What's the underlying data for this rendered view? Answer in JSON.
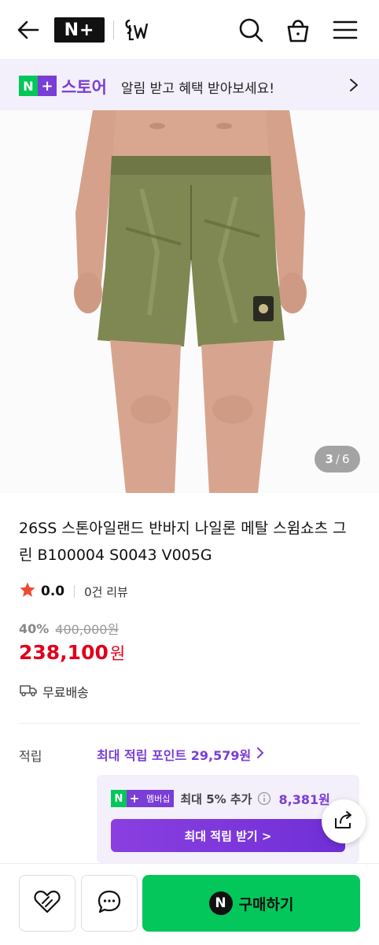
{
  "header": {
    "logo_text": "N+",
    "icons": [
      "back-arrow-icon",
      "search-icon",
      "shopping-bag-icon",
      "hamburger-menu-icon"
    ],
    "brand_logo_icon": "brand-logo-icon"
  },
  "store_banner": {
    "badge_n": "N",
    "badge_plus": "+",
    "store_label": "스토어",
    "message": "알림 받고 혜택 받아보세요!"
  },
  "gallery": {
    "current": "3",
    "separator": "/",
    "total": "6"
  },
  "product": {
    "title": "26SS 스톤아일랜드 반바지 나일론 메탈 스윔쇼츠 그린 B100004 S0043 V005G",
    "rating": "0.0",
    "review_count": "0건 리뷰",
    "discount": "40%",
    "original_price": "400,000원",
    "price": "238,100",
    "price_unit": "원",
    "shipping": "무료배송"
  },
  "points": {
    "label": "적립",
    "max_text": "최대 적립 포인트 29,579원",
    "membership_badge_n": "N",
    "membership_badge_plus": "+",
    "membership_badge_label": "멤버십",
    "membership_text": "최대 5% 추가",
    "membership_amount": "8,381원",
    "max_button": "최대 적립 받기 >"
  },
  "bottom_bar": {
    "buy_badge": "N",
    "buy_label": "구매하기"
  },
  "colors": {
    "naver_green": "#03c75a",
    "plus_purple": "#7a3dd6",
    "price_red": "#e0001b",
    "banner_bg": "#f3effb"
  }
}
